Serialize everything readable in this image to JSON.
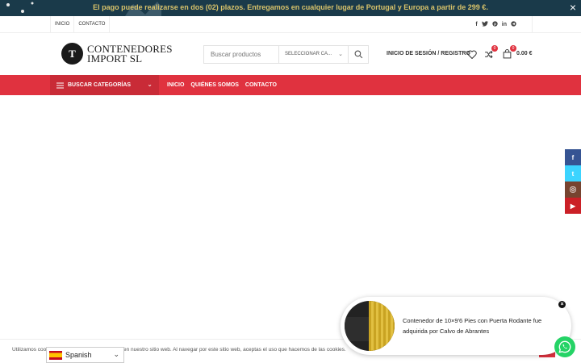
{
  "promo": {
    "text": "El pago puede realizarse en dos (02) plazos. Entregamos en cualquier lugar de Portugal y Europa a partir de 299 €.",
    "close": "×"
  },
  "topbar": {
    "links": [
      "INICIO",
      "CONTACTO"
    ],
    "social": [
      "f",
      "t",
      "p",
      "in",
      "tg"
    ]
  },
  "header": {
    "logo_mark": "T",
    "logo_line1": "CONTENEDORES",
    "logo_line2": "IMPORT SL",
    "search_placeholder": "Buscar productos",
    "category_select": "SELECCIONAR CA...",
    "login": "INICIO DE SESIÓN / REGISTRO",
    "compare_count": "0",
    "cart_count": "0",
    "cart_total": "0.00 €"
  },
  "mainnav": {
    "categories_label": "BUSCAR CATEGORÍAS",
    "items": [
      "INICIO",
      "QUIÉNES SOMOS",
      "CONTACTO"
    ]
  },
  "side_social": [
    {
      "icon": "f",
      "color": "#365493"
    },
    {
      "icon": "t",
      "color": "#3cd4ff"
    },
    {
      "icon": "ig",
      "color": "#774430"
    },
    {
      "icon": "▶",
      "color": "#cb2027"
    }
  ],
  "cookie": {
    "text": "Utilizamos cookies para mejorar su experiencia en nuestro sitio web. Al navegar por este sitio web, aceptas el uso que hacemos de las cookies."
  },
  "language": {
    "selected": "Spanish"
  },
  "popup": {
    "message": "Contenedor de 10×9'6 Pies con Puerta Rodante fue adquirida por Calvo de Abrantes"
  },
  "colors": {
    "accent": "#e0323f",
    "accent_dark": "#c92b37",
    "promo_bg": "#1a3a4a",
    "promo_text": "#d9c36a",
    "whatsapp": "#25d366"
  }
}
